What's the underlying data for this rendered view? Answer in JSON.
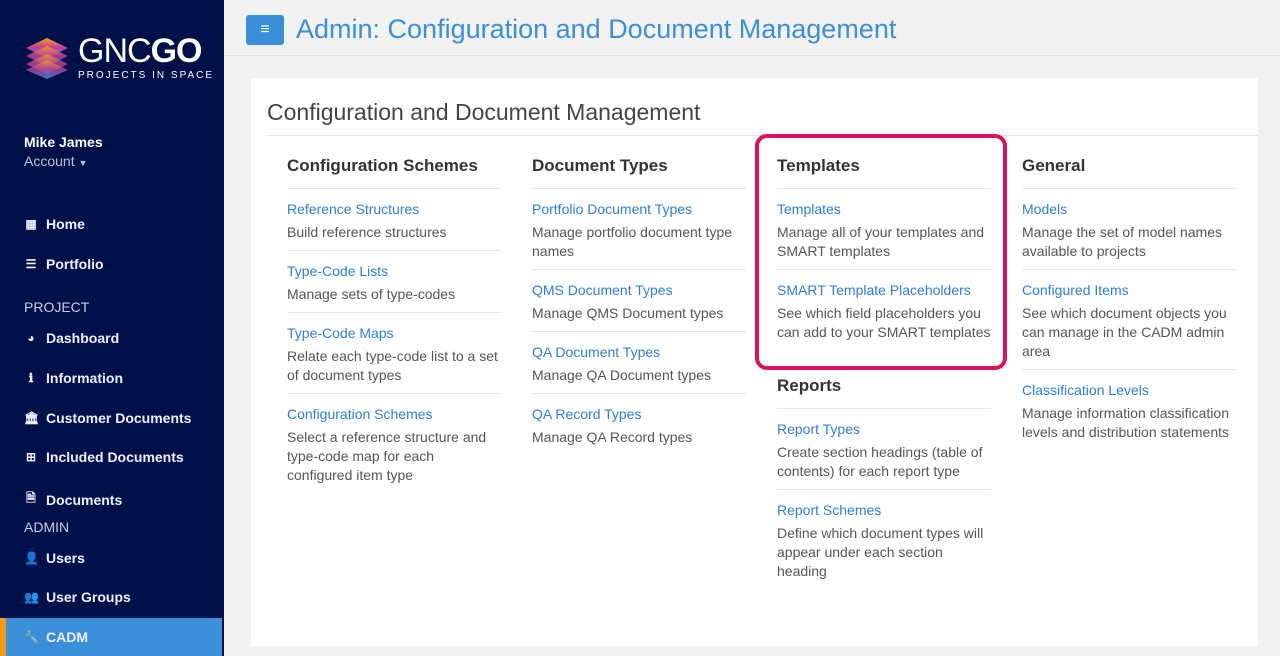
{
  "logo": {
    "brand_light": "GNC",
    "brand_bold": "GO",
    "tagline": "PROJECTS IN SPACE"
  },
  "user": {
    "name": "Mike James",
    "account": "Account"
  },
  "sidebar": {
    "items": [
      {
        "label": "Home",
        "icon": "th-large-icon"
      },
      {
        "label": "Portfolio",
        "icon": "list-icon"
      },
      {
        "section": "PROJECT"
      },
      {
        "label": "Dashboard",
        "icon": "dashboard-icon"
      },
      {
        "label": "Information",
        "icon": "info-icon"
      },
      {
        "label": "Customer Documents",
        "icon": "bank-icon"
      },
      {
        "label": "Included Documents",
        "icon": "plus-square-icon"
      },
      {
        "label": "Documents",
        "icon": "word-file-icon"
      },
      {
        "section": "ADMIN"
      },
      {
        "label": "Users",
        "icon": "user-icon"
      },
      {
        "label": "User Groups",
        "icon": "users-icon"
      },
      {
        "label": "CADM",
        "icon": "wrench-icon",
        "active": true
      }
    ]
  },
  "header": {
    "title": "Admin: Configuration and Document Management",
    "menu_icon": "≡"
  },
  "panel": {
    "title": "Configuration and Document Management",
    "columns": [
      {
        "heading": "Configuration Schemes",
        "entries": [
          {
            "link": "Reference Structures",
            "desc": "Build reference structures"
          },
          {
            "link": "Type-Code Lists",
            "desc": "Manage sets of type-codes"
          },
          {
            "link": "Type-Code Maps",
            "desc": "Relate each type-code list to a set of document types"
          },
          {
            "link": "Configuration Schemes",
            "desc": "Select a reference structure and type-code map for each configured item type"
          }
        ]
      },
      {
        "heading": "Document Types",
        "entries": [
          {
            "link": "Portfolio Document Types",
            "desc": "Manage portfolio document type names"
          },
          {
            "link": "QMS Document Types",
            "desc": "Manage QMS Document types"
          },
          {
            "link": "QA Document Types",
            "desc": "Manage QA Document types"
          },
          {
            "link": "QA Record Types",
            "desc": "Manage QA Record types"
          }
        ]
      },
      {
        "heading": "Templates",
        "entries": [
          {
            "link": "Templates",
            "desc": "Manage all of your templates and SMART templates"
          },
          {
            "link": "SMART Template Placeholders",
            "desc": "See which field placeholders you can add to your SMART templates"
          }
        ]
      },
      {
        "heading": "Reports",
        "entries": [
          {
            "link": "Report Types",
            "desc": "Create section headings (table of contents) for each report type"
          },
          {
            "link": "Report Schemes",
            "desc": "Define which document types will appear under each section heading"
          }
        ]
      },
      {
        "heading": "General",
        "entries": [
          {
            "link": "Models",
            "desc": "Manage the set of model names available to projects"
          },
          {
            "link": "Configured Items",
            "desc": "See which document objects you can manage in the CADM admin area"
          },
          {
            "link": "Classification Levels",
            "desc": "Manage information classification levels and distribution statements"
          }
        ]
      }
    ]
  },
  "colors": {
    "sidebar": "#00114a",
    "accent": "#3b8fd8",
    "link": "#2d7fd3",
    "highlight": "#d8145e"
  }
}
